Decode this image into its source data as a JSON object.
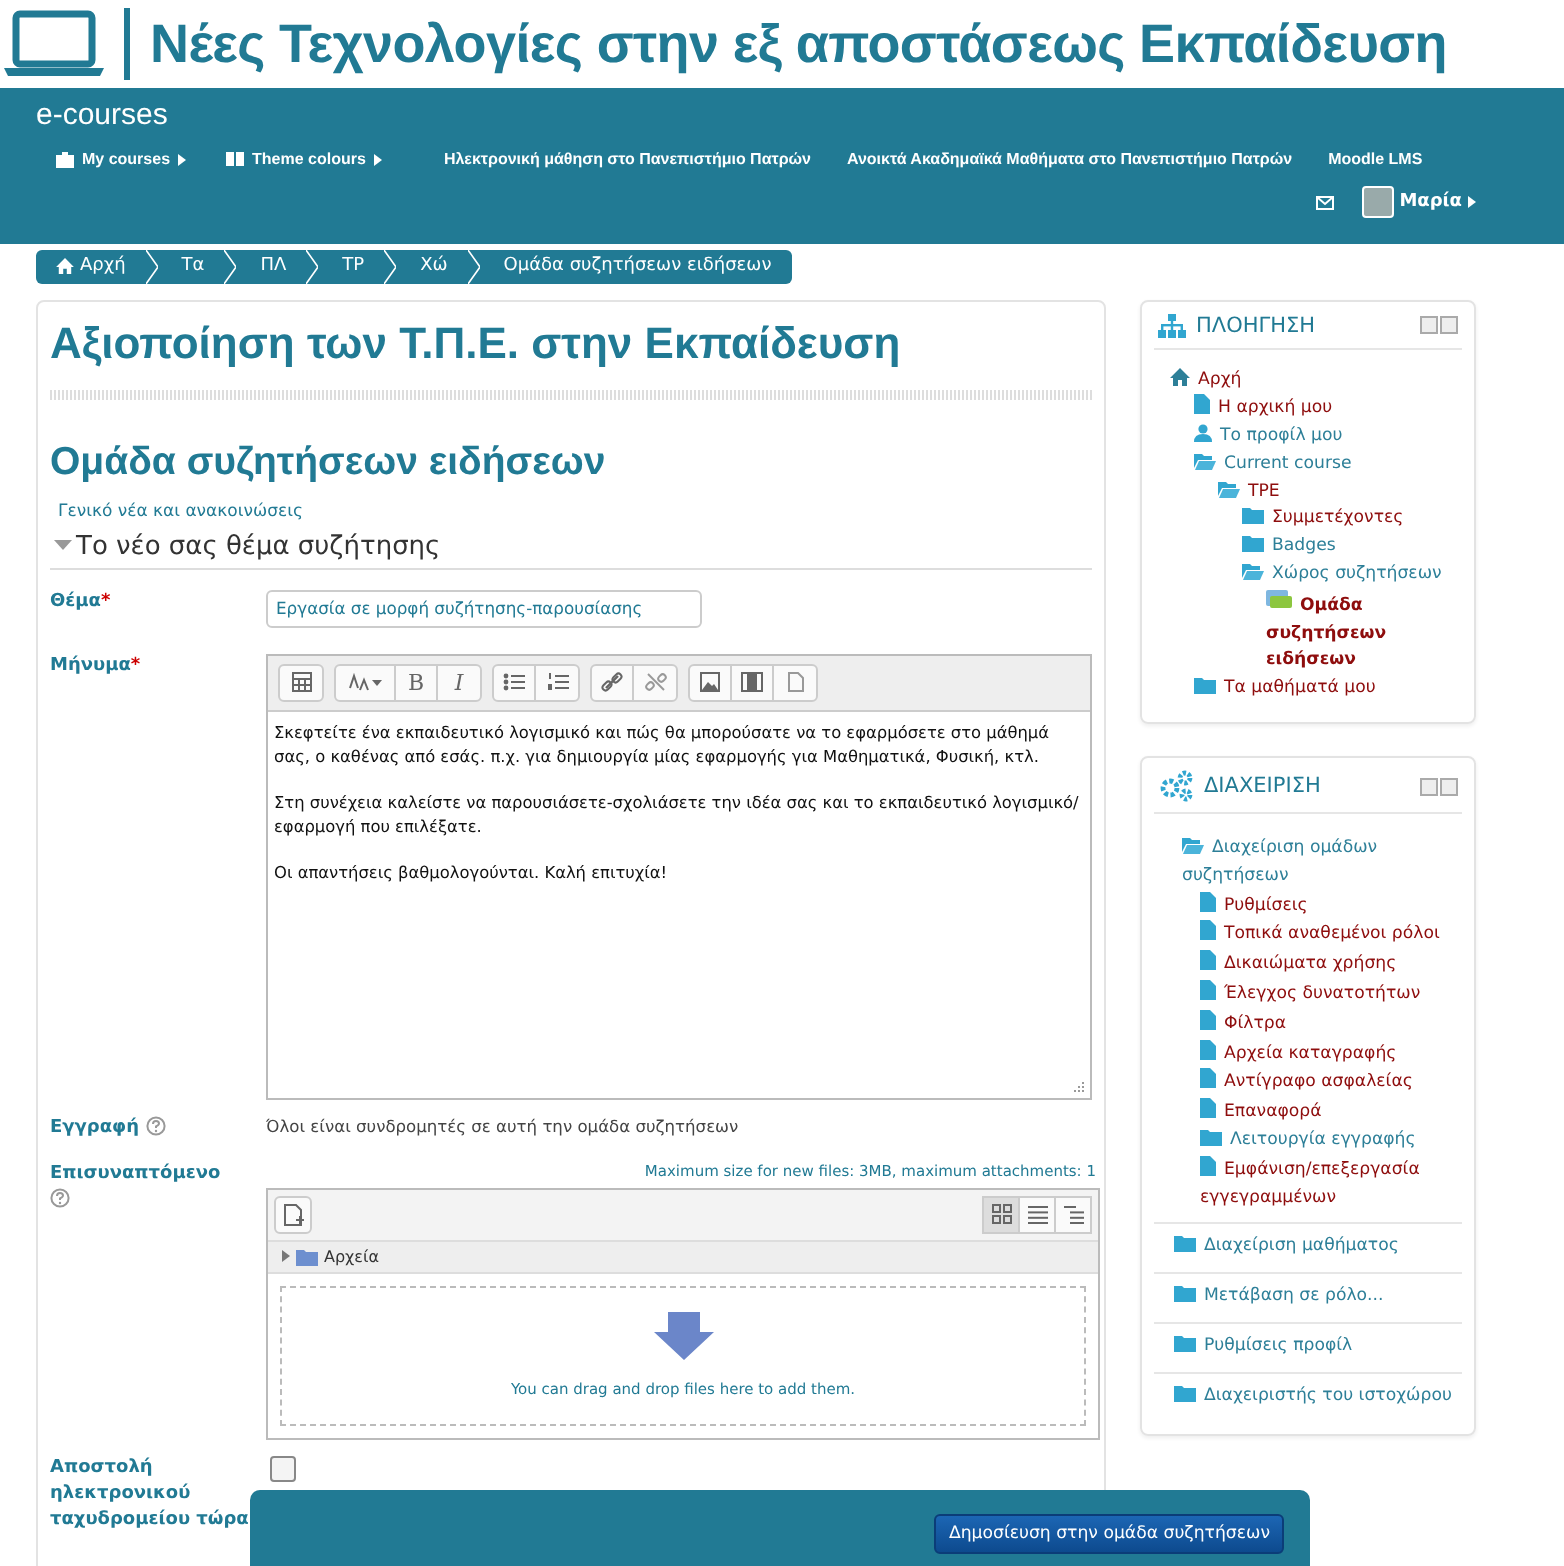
{
  "header": {
    "title": "Νέες Τεχνολογίες στην εξ αποστάσεως Εκπαίδευση"
  },
  "navbar": {
    "brand": "e-courses",
    "menu": [
      {
        "label": "My courses",
        "kind": "briefcase",
        "dropdown": true
      },
      {
        "label": "Theme colours",
        "kind": "palette",
        "dropdown": true
      },
      {
        "label": "Ηλεκτρονική μάθηση στο Πανεπιστήμιο Πατρών",
        "kind": "plain",
        "dropdown": false
      },
      {
        "label": "Ανοικτά Ακαδημαϊκά Μαθήματα στο Πανεπιστήμιο Πατρών",
        "kind": "plain",
        "dropdown": false
      },
      {
        "label": "Moodle LMS",
        "kind": "plain",
        "dropdown": false
      }
    ],
    "user": {
      "name": "Μαρία"
    }
  },
  "breadcrumb": [
    {
      "label": "Αρχή",
      "kind": "home"
    },
    {
      "label": "Τα",
      "kind": "plain"
    },
    {
      "label": "ΠΛ",
      "kind": "plain"
    },
    {
      "label": "TP",
      "kind": "plain"
    },
    {
      "label": "Χώ",
      "kind": "plain"
    },
    {
      "label": "Ομάδα συζητήσεων ειδήσεων",
      "kind": "plain"
    }
  ],
  "course_title": "Αξιοποίηση των Τ.Π.Ε. στην Εκπαίδευση",
  "forum_title": "Ομάδα συζητήσεων ειδήσεων",
  "forum_intro": "Γενικό νέα και ανακοινώσεις",
  "form": {
    "section": {
      "title": "Το νέο σας θέμα συζήτησης",
      "expanded": true
    },
    "subject": {
      "label": "Θέμα",
      "required_mark": "*",
      "value": "Εργασία σε μορφή συζήτησης-παρουσίασης"
    },
    "message": {
      "label": "Μήνυμα",
      "required_mark": "*",
      "toolbar": [
        [
          {
            "kind": "table"
          }
        ],
        [
          {
            "kind": "font-size"
          },
          {
            "kind": "bold",
            "label": "B"
          },
          {
            "kind": "italic",
            "label": "I"
          }
        ],
        [
          {
            "kind": "bullets"
          },
          {
            "kind": "numbers"
          }
        ],
        [
          {
            "kind": "link"
          },
          {
            "kind": "unlink"
          }
        ],
        [
          {
            "kind": "image"
          },
          {
            "kind": "media"
          },
          {
            "kind": "save"
          }
        ]
      ],
      "paragraphs": [
        "Σκεφτείτε ένα εκπαιδευτικό λογισμικό και πώς θα μπορούσατε να το εφαρμόσετε στο μάθημά σας, ο καθένας από εσάς. π.χ. για δημιουργία μίας εφαρμογής για Μαθηματικά, Φυσική, κτλ.",
        "Στη συνέχεια καλείστε να παρουσιάσετε-σχολιάσετε την ιδέα σας και το εκπαιδευτικό λογισμικό/εφαρμογή που επιλέξατε.",
        "Οι απαντήσεις βαθμολογούνται. Καλή επιτυχία!"
      ]
    },
    "subscription": {
      "label": "Εγγραφή",
      "text": "Όλοι είναι συνδρομητές σε αυτή την ομάδα συζητήσεων"
    },
    "attachment": {
      "label": "Επισυναπτόμενο",
      "limits": "Maximum size for new files: 3MB, maximum attachments: 1",
      "folder": "Αρχεία",
      "drop_hint": "You can drag and drop files here to add them.",
      "views": [
        {
          "kind": "grid",
          "selected": true
        },
        {
          "kind": "list",
          "selected": false
        },
        {
          "kind": "tree",
          "selected": false
        }
      ]
    },
    "mail_now": {
      "label": "Αποστολή ηλεκτρονικού ταχυδρομείου τώρα",
      "checked": false
    },
    "submit": "Δημοσίευση στην ομάδα συζητήσεων"
  },
  "blocks": [
    {
      "title": "ΠΛΟΗΓΗΣΗ",
      "kind": "navigation",
      "sections": [
        {
          "label": "Αρχή",
          "kind": "home",
          "link": true,
          "selected": false,
          "children": [
            {
              "label": "Η αρχική μου",
              "kind": "page",
              "link": true,
              "selected": false
            },
            {
              "label": "Το προφίλ μου",
              "kind": "person",
              "link": false,
              "selected": false
            },
            {
              "label": "Current course",
              "kind": "folder-open",
              "link": false,
              "selected": false,
              "children": [
                {
                  "label": "TPE",
                  "kind": "folder-open",
                  "link": true,
                  "selected": false,
                  "children": [
                    {
                      "label": "Συμμετέχοντες",
                      "kind": "folder",
                      "link": true,
                      "selected": false
                    },
                    {
                      "label": "Badges",
                      "kind": "folder",
                      "link": false,
                      "selected": false
                    },
                    {
                      "label": "Χώρος συζητήσεων",
                      "kind": "folder-open",
                      "link": false,
                      "selected": false,
                      "children": [
                        {
                          "label": "Ομάδα συζητήσεων ειδήσεων",
                          "kind": "forum",
                          "link": true,
                          "selected": true
                        }
                      ]
                    }
                  ]
                }
              ]
            },
            {
              "label": "Τα μαθήματά μου",
              "kind": "folder",
              "link": true,
              "selected": false
            }
          ]
        }
      ]
    },
    {
      "title": "ΔΙΑΧΕΙΡΙΣΗ",
      "kind": "settings",
      "sections": [
        {
          "label": "Διαχείριση ομάδων συζητήσεων",
          "kind": "folder-open",
          "link": false,
          "selected": false,
          "children": [
            {
              "label": "Ρυθμίσεις",
              "kind": "page",
              "link": true,
              "selected": false
            },
            {
              "label": "Τοπικά αναθεμένοι ρόλοι",
              "kind": "page",
              "link": true,
              "selected": false
            },
            {
              "label": "Δικαιώματα χρήσης",
              "kind": "page",
              "link": true,
              "selected": false
            },
            {
              "label": "Έλεγχος δυνατοτήτων",
              "kind": "page",
              "link": true,
              "selected": false
            },
            {
              "label": "Φίλτρα",
              "kind": "page",
              "link": true,
              "selected": false
            },
            {
              "label": "Αρχεία καταγραφής",
              "kind": "page",
              "link": true,
              "selected": false
            },
            {
              "label": "Αντίγραφο ασφαλείας",
              "kind": "page",
              "link": true,
              "selected": false
            },
            {
              "label": "Επαναφορά",
              "kind": "page",
              "link": true,
              "selected": false
            },
            {
              "label": "Λειτουργία εγγραφής",
              "kind": "folder",
              "link": false,
              "selected": false
            },
            {
              "label": "Εμφάνιση/επεξεργασία εγγεγραμμένων",
              "kind": "page",
              "link": true,
              "selected": false
            }
          ]
        },
        {
          "label": "Διαχείριση μαθήματος",
          "kind": "folder",
          "link": false,
          "selected": false
        },
        {
          "label": "Μετάβαση σε ρόλο...",
          "kind": "folder",
          "link": false,
          "selected": false
        },
        {
          "label": "Ρυθμίσεις προφίλ",
          "kind": "folder",
          "link": false,
          "selected": false
        },
        {
          "label": "Διαχειριστής του ιστοχώρου",
          "kind": "folder",
          "link": false,
          "selected": false
        }
      ]
    }
  ]
}
